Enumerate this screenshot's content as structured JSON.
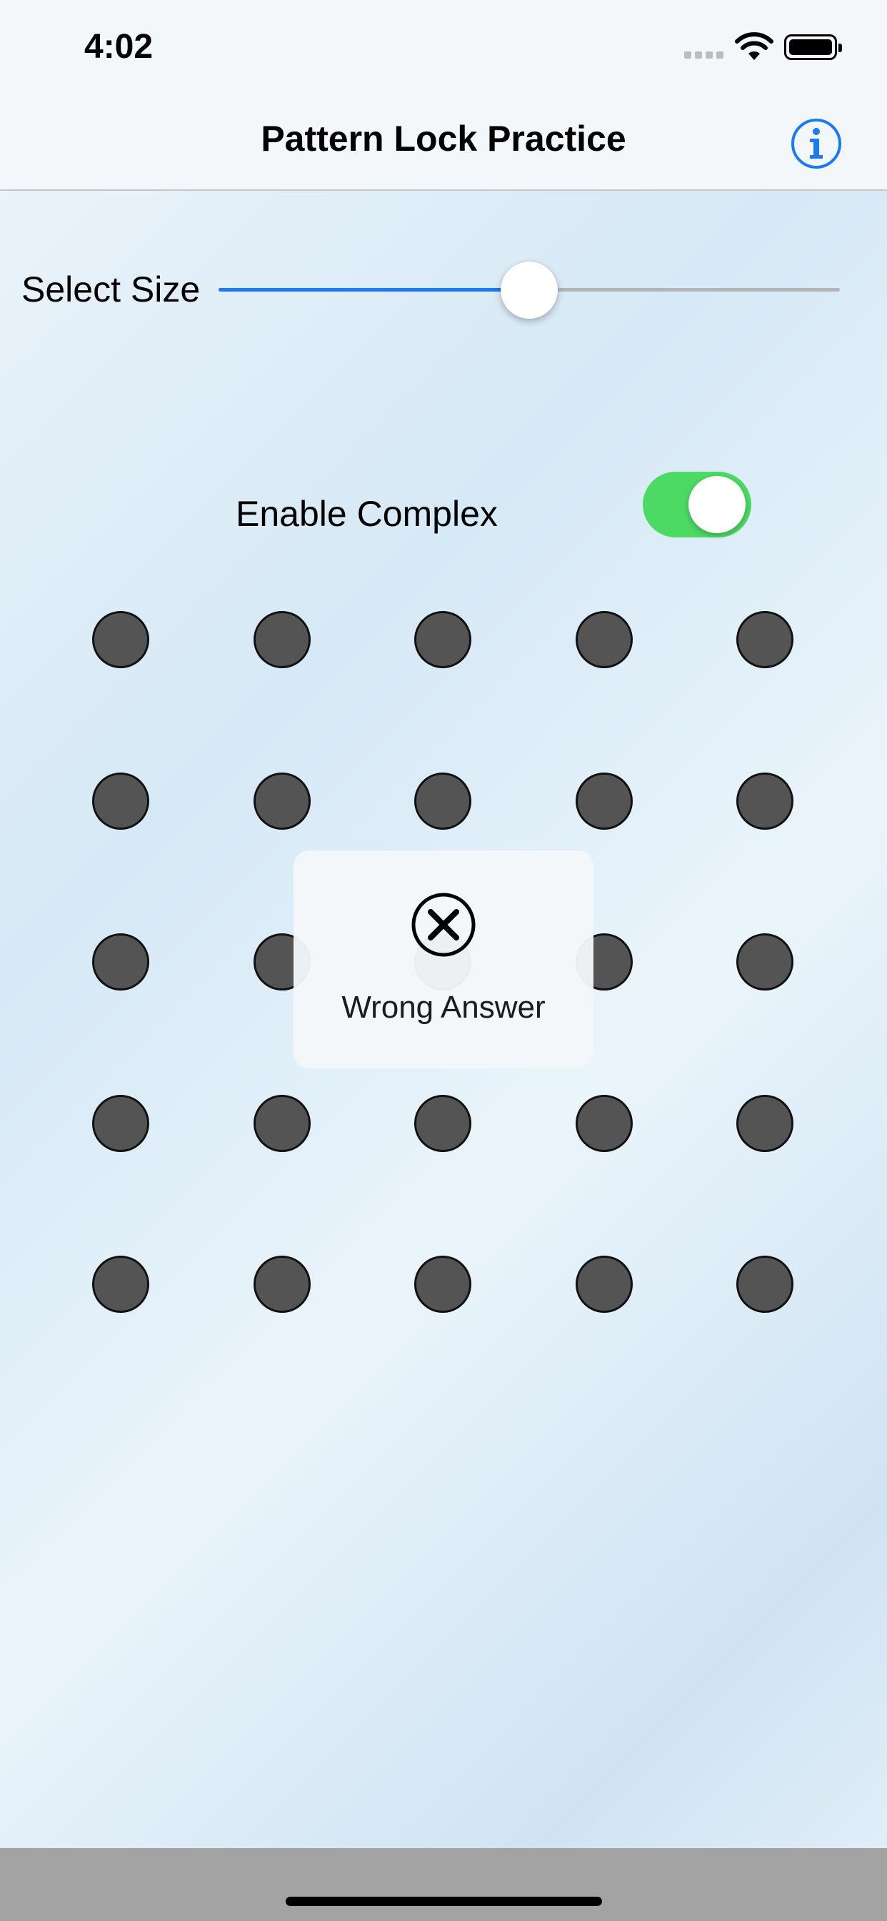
{
  "status_bar": {
    "time": "4:02"
  },
  "nav": {
    "title": "Pattern Lock Practice",
    "info_icon": "info-icon"
  },
  "size_control": {
    "label": "Select Size",
    "value_fraction": 0.5,
    "accent_color": "#1a7bf2"
  },
  "complex_toggle": {
    "label": "Enable Complex",
    "on": true,
    "color": "#4cd964"
  },
  "grid": {
    "rows": 5,
    "cols": 5,
    "dot_color": "#545454"
  },
  "toast": {
    "message": "Wrong Answer",
    "icon": "x-circle-icon"
  }
}
